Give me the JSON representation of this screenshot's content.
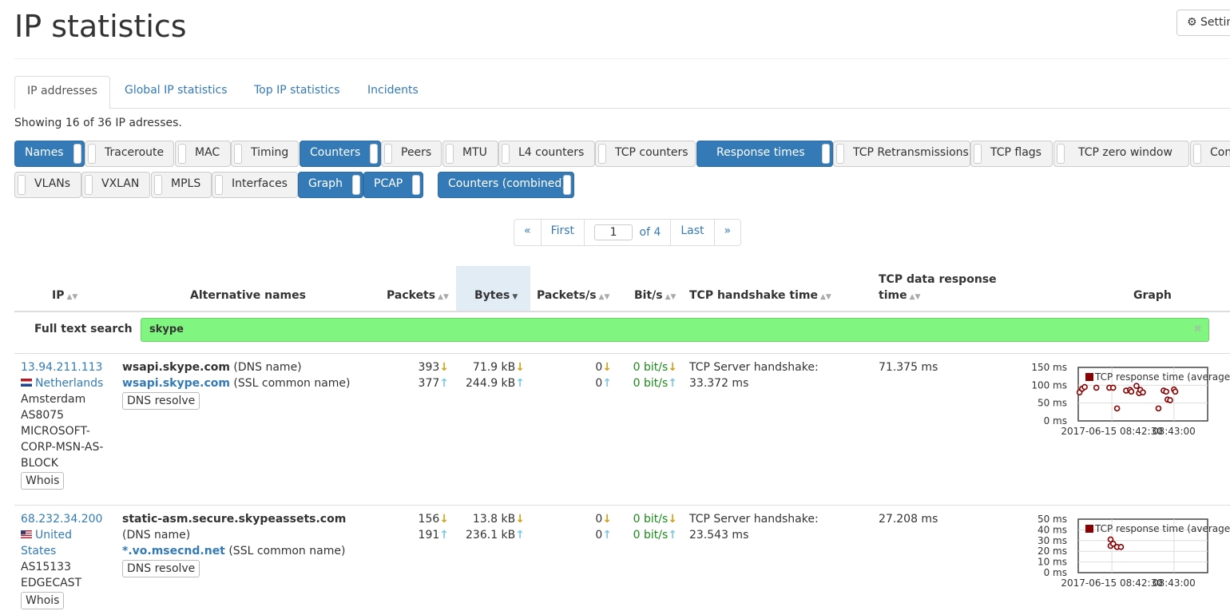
{
  "title": "IP statistics",
  "settings_label": "Settings",
  "tabs": [
    {
      "label": "IP addresses",
      "active": true
    },
    {
      "label": "Global IP statistics"
    },
    {
      "label": "Top IP statistics"
    },
    {
      "label": "Incidents"
    }
  ],
  "showing": "Showing 16 of 36 IP adresses.",
  "column_toggles": [
    {
      "label": "Names",
      "on": true
    },
    {
      "label": "Traceroute",
      "on": false
    },
    {
      "label": "MAC",
      "on": false
    },
    {
      "label": "Timing",
      "on": false
    },
    {
      "label": "Counters",
      "on": true
    },
    {
      "label": "Peers",
      "on": false
    },
    {
      "label": "MTU",
      "on": false
    },
    {
      "label": "L4 counters",
      "on": false
    },
    {
      "label": "TCP counters",
      "on": false
    },
    {
      "label": "Response times",
      "on": true
    },
    {
      "label": "TCP Retransmissions",
      "on": false
    },
    {
      "label": "TCP flags",
      "on": false
    },
    {
      "label": "TCP zero window",
      "on": false
    },
    {
      "label": "Con",
      "on": false
    },
    {
      "label": "VLANs",
      "on": false
    },
    {
      "label": "VXLAN",
      "on": false
    },
    {
      "label": "MPLS",
      "on": false
    },
    {
      "label": "Interfaces",
      "on": false
    },
    {
      "label": "Graph",
      "on": true
    },
    {
      "label": "PCAP",
      "on": true
    },
    {
      "label": "Counters (combined)",
      "on": true
    }
  ],
  "pager": {
    "prev": "«",
    "first": "First",
    "page": "1",
    "of": "of 4",
    "last": "Last",
    "next": "»"
  },
  "columns": {
    "ip": "IP",
    "alt_names": "Alternative names",
    "packets": "Packets",
    "bytes": "Bytes",
    "packets_s": "Packets/s",
    "bits_s": "Bit/s",
    "handshake": "TCP handshake time",
    "data_response_1": "TCP data response",
    "data_response_2": "time",
    "graph": "Graph"
  },
  "search": {
    "label": "Full text search",
    "value": "skype",
    "clear": "✖"
  },
  "rows": [
    {
      "ip": "13.94.211.113",
      "country": "Netherlands",
      "info": [
        "Amsterdam",
        "AS8075",
        "MICROSOFT-",
        "CORP-MSN-AS-",
        "BLOCK"
      ],
      "whois": "Whois",
      "name1": "wsapi.skype.com",
      "name1_type": "(DNS name)",
      "name2": "wsapi.skype.com",
      "name2_type": "(SSL common name)",
      "dns_resolve": "DNS resolve",
      "packets_in": "393",
      "packets_out": "377",
      "bytes_in": "71.9 kB",
      "bytes_out": "244.9 kB",
      "pps_in": "0",
      "pps_out": "0",
      "bits_in": "0 bit/s",
      "bits_out": "0 bit/s",
      "handshake_1": "TCP Server handshake:",
      "handshake_2": "33.372 ms",
      "data_response": "71.375 ms",
      "graph": {
        "y_ticks": [
          "150 ms",
          "100 ms",
          "50 ms",
          "0 ms"
        ],
        "x_ticks": [
          "2017-06-15 08:42:30",
          "08:43:00"
        ],
        "legend": "TCP response time (average)",
        "ymax": 150,
        "points": [
          [
            0.01,
            80
          ],
          [
            0.03,
            90
          ],
          [
            0.05,
            95
          ],
          [
            0.14,
            93
          ],
          [
            0.24,
            93
          ],
          [
            0.27,
            93
          ],
          [
            0.3,
            35
          ],
          [
            0.37,
            85
          ],
          [
            0.4,
            87
          ],
          [
            0.41,
            82
          ],
          [
            0.45,
            98
          ],
          [
            0.47,
            78
          ],
          [
            0.48,
            87
          ],
          [
            0.5,
            80
          ],
          [
            0.62,
            35
          ],
          [
            0.66,
            85
          ],
          [
            0.68,
            82
          ],
          [
            0.69,
            60
          ],
          [
            0.71,
            58
          ],
          [
            0.74,
            88
          ],
          [
            0.75,
            82
          ]
        ]
      }
    },
    {
      "ip": "68.232.34.200",
      "country": "United",
      "country2": "States",
      "info": [
        "AS15133",
        "EDGECAST"
      ],
      "whois": "Whois",
      "name1": "static-asm.secure.skypeassets.com",
      "name1_type": "(DNS name)",
      "name2": "*.vo.msecnd.net",
      "name2_type": "(SSL common name)",
      "dns_resolve": "DNS resolve",
      "packets_in": "156",
      "packets_out": "191",
      "bytes_in": "13.8 kB",
      "bytes_out": "236.1 kB",
      "pps_in": "0",
      "pps_out": "0",
      "bits_in": "0 bit/s",
      "bits_out": "0 bit/s",
      "handshake_1": "TCP Server handshake:",
      "handshake_2": "23.543 ms",
      "data_response": "27.208 ms",
      "graph": {
        "y_ticks": [
          "50 ms",
          "40 ms",
          "30 ms",
          "20 ms",
          "10 ms",
          "0 ms"
        ],
        "x_ticks": [
          "2017-06-15 08:42:30",
          "08:43:00"
        ],
        "legend": "TCP response time (average)",
        "ymax": 50,
        "points": [
          [
            0.25,
            31
          ],
          [
            0.25,
            25
          ],
          [
            0.27,
            27
          ],
          [
            0.3,
            24
          ],
          [
            0.33,
            24
          ]
        ]
      }
    }
  ]
}
